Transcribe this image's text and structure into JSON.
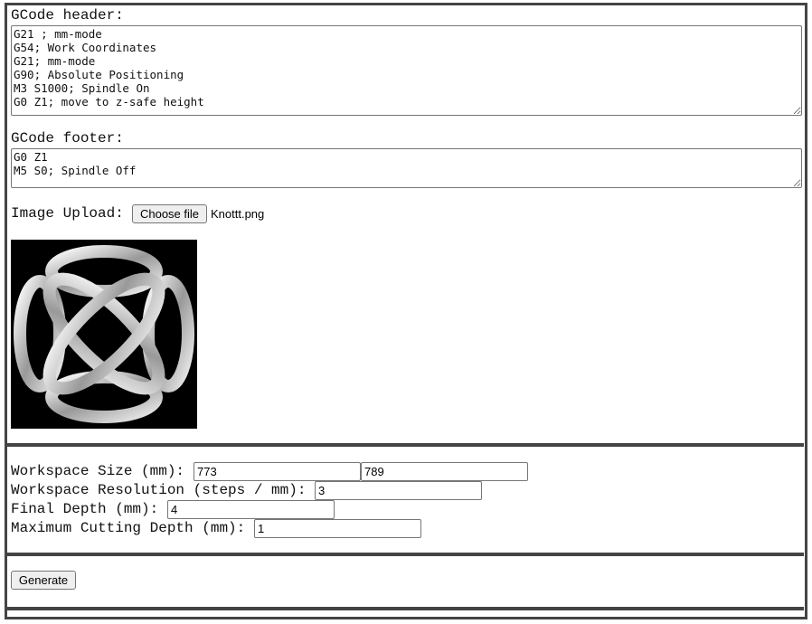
{
  "header_label": "GCode header:",
  "header_value": "G21 ; mm-mode\nG54; Work Coordinates\nG21; mm-mode\nG90; Absolute Positioning\nM3 S1000; Spindle On\nG0 Z1; move to z-safe height",
  "footer_label": "GCode footer:",
  "footer_value": "G0 Z1\nM5 S0; Spindle Off",
  "upload_label": "Image Upload:",
  "choose_file": "Choose file",
  "file_name": "Knottt.png",
  "workspace_size_label": "Workspace Size (mm):",
  "workspace_x": "773",
  "workspace_y": "789",
  "resolution_label": "Workspace Resolution (steps / mm):",
  "resolution": "3",
  "final_depth_label": "Final Depth (mm):",
  "final_depth": "4",
  "max_cut_label": "Maximum Cutting Depth (mm):",
  "max_cut": "1",
  "generate": "Generate"
}
